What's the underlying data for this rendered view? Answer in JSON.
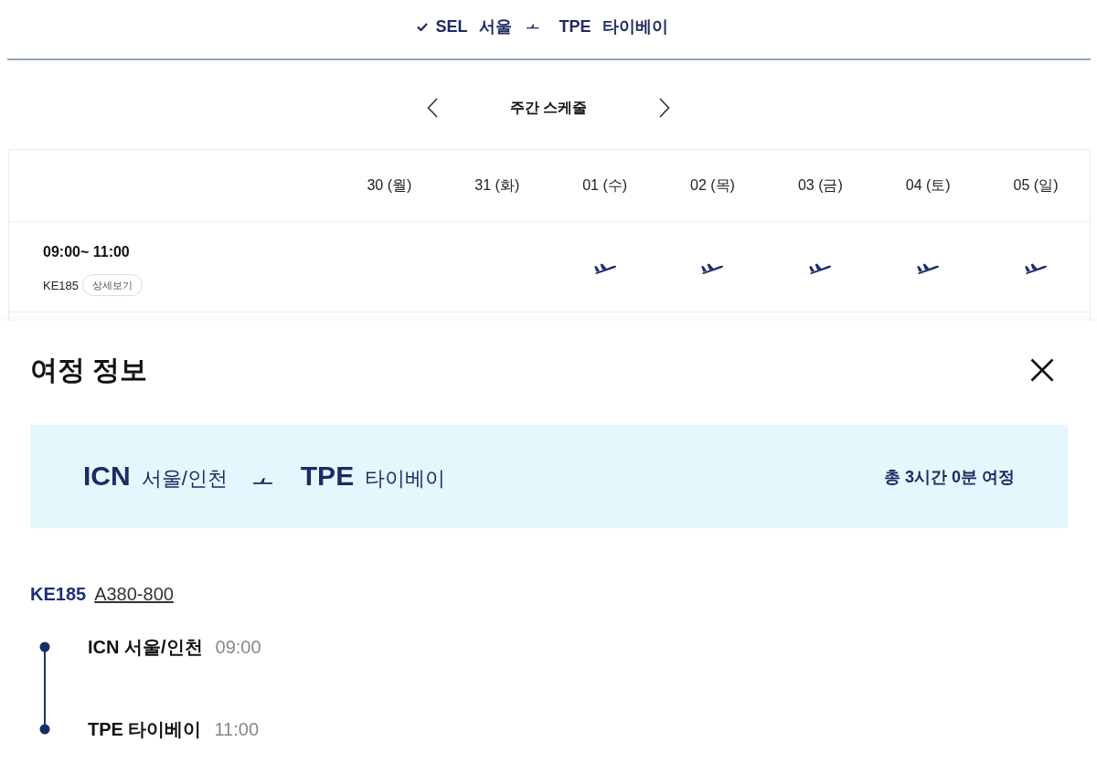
{
  "route_header": {
    "origin_code": "SEL",
    "origin_city": "서울",
    "destination_code": "TPE",
    "destination_city": "타이베이"
  },
  "week_nav": {
    "title": "주간 스케줄"
  },
  "schedule": {
    "days": [
      "30 (월)",
      "31 (화)",
      "01 (수)",
      "02 (목)",
      "03 (금)",
      "04 (토)",
      "05 (일)"
    ],
    "rows": [
      {
        "time": "09:00~ 11:00",
        "flight": "KE185",
        "details_button": "상세보기",
        "days": [
          {
            "flight": false
          },
          {
            "flight": false
          },
          {
            "flight": true
          },
          {
            "flight": true
          },
          {
            "flight": true
          },
          {
            "flight": true
          },
          {
            "flight": true
          }
        ]
      }
    ]
  },
  "itinerary": {
    "title": "여정 정보",
    "summary": {
      "origin_code": "ICN",
      "origin_city": "서울/인천",
      "destination_code": "TPE",
      "destination_city": "타이베이",
      "duration": "총 3시간 0분 여정"
    },
    "flight": {
      "number": "KE185",
      "aircraft": "A380-800"
    },
    "stops": [
      {
        "label": "ICN 서울/인천",
        "time": "09:00"
      },
      {
        "label": "TPE 타이베이",
        "time": "11:00"
      }
    ]
  }
}
